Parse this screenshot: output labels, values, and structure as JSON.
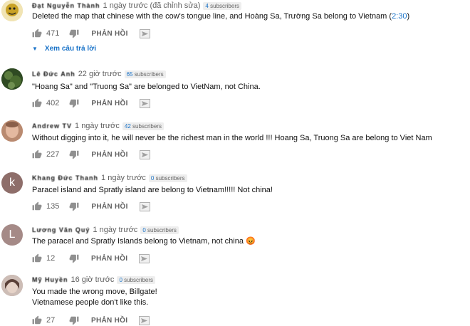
{
  "comments": [
    {
      "author": "Đạt Nguyễn Thành",
      "time": "1 ngày trước (đã chỉnh sửa)",
      "subscribers_count": "4",
      "subscribers_word": "subscribers",
      "text": "Deleted the map that chinese with the cow's tongue line, and Hoàng Sa, Trường Sa belong to Vietnam (",
      "link": "2:30",
      "text_after": ")",
      "likes": "471",
      "reply_label": "PHẢN HỒI",
      "avatar_color": "#c9a227"
    },
    {
      "author": "Lê Đức Anh",
      "time": "22 giờ trước",
      "subscribers_count": "65",
      "subscribers_word": "subscribers",
      "text": "\"Hoang Sa\" and  \"Truong Sa\" are belonged to VietNam, not China.",
      "likes": "402",
      "reply_label": "PHẢN HỒI",
      "avatar_color": "#3c5a2c"
    },
    {
      "author": "Andrew TV",
      "time": "1 ngày trước",
      "subscribers_count": "42",
      "subscribers_word": "subscribers",
      "text": "Without digging into it, he will never be the richest man in the world !!!  Hoang Sa, Truong Sa are belong to  Viet Nam",
      "likes": "227",
      "reply_label": "PHẢN HỒI",
      "avatar_color": "#d8a58a"
    },
    {
      "author": "Khang Đức Thanh",
      "time": "1 ngày trước",
      "subscribers_count": "0",
      "subscribers_word": "subscribers",
      "text": "Paracel island and Spratly island are belong to Vietnam!!!!! Not china!",
      "likes": "135",
      "reply_label": "PHẢN HỒI",
      "avatar_letter": "k",
      "avatar_color": "#8e6e6a"
    },
    {
      "author": "Lương Văn Quý",
      "time": "1 ngày trước",
      "subscribers_count": "0",
      "subscribers_word": "subscribers",
      "text": "The paracel and Spratly Islands belong to Vietnam, not china 😡",
      "likes": "12",
      "reply_label": "PHẢN HỒI",
      "avatar_letter": "L",
      "avatar_color": "#a58a87"
    },
    {
      "author": "Mỹ Huyền",
      "time": "16 giờ trước",
      "subscribers_count": "0",
      "subscribers_word": "subscribers",
      "text": "You made the wrong move, Billgate!\nVietnamese people don't like this.",
      "likes": "27",
      "reply_label": "PHẢN HỒI",
      "avatar_color": "#b7a6a0"
    }
  ],
  "view_replies_label": "Xem câu trả lời",
  "icons": {
    "like": "thumbs-up-icon",
    "dislike": "thumbs-down-icon",
    "send": "send-icon",
    "expand": "caret-down-icon"
  }
}
